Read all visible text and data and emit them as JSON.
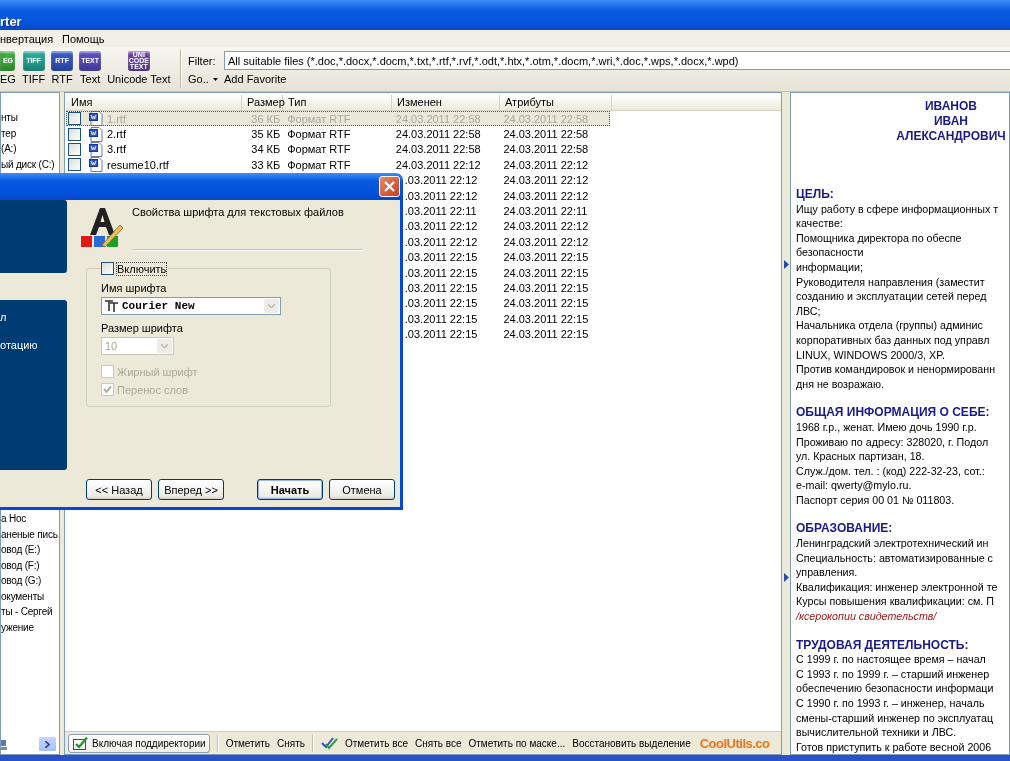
{
  "window": {
    "title": "rter"
  },
  "menu": [
    {
      "label": "нвертация"
    },
    {
      "label": "Помощь"
    }
  ],
  "toolbar": {
    "formats": [
      {
        "badge": "EG",
        "label": "EG",
        "color": "#3fae3c"
      },
      {
        "badge": "TIFF",
        "label": "TIFF",
        "color": "#27a89a"
      },
      {
        "badge": "RTF",
        "label": "RTF",
        "color": "#3558c4"
      },
      {
        "badge": "TEXT",
        "label": "Text",
        "color": "#5a4cc0"
      },
      {
        "badge": "UNI CODE TEXT",
        "label": "Unicode Text",
        "color": "#6d45b0"
      }
    ],
    "filter_label": "Filter:",
    "filter_value": "All suitable files (*.doc,*.docx,*.docm,*.txt,*.rtf,*.rvf,*.odt,*.htx,*.otm,*.docm,*.wri,*.doc,*.wps,*.docx,*.wpd)",
    "go": "Go..",
    "add_favorite": "Add Favorite"
  },
  "tree": {
    "items_top": [
      {
        "label": "нты"
      },
      {
        "label": "тер"
      },
      {
        "label": "(A:)"
      },
      {
        "label": "ый диск (C:)"
      }
    ],
    "items_bottom": [
      {
        "label": "а Нос"
      },
      {
        "label": "аненые пись"
      },
      {
        "label": "овод (E:)"
      },
      {
        "label": "овод (F:)"
      },
      {
        "label": "овод (G:)"
      },
      {
        "label": "окументы"
      },
      {
        "label": "ты - Сергей"
      },
      {
        "label": "ужение"
      }
    ]
  },
  "file_list": {
    "columns": [
      "Имя",
      "Размер",
      "Тип",
      "Изменен",
      "Атрибуты"
    ],
    "rows": [
      {
        "selected": true,
        "checked": false,
        "name": "1.rtf",
        "size": "36 КБ",
        "type": "Формат RTF",
        "modified": "24.03.2011 22:58",
        "attributes": "24.03.2011 22:58"
      },
      {
        "selected": false,
        "checked": false,
        "name": "2.rtf",
        "size": "35 КБ",
        "type": "Формат RTF",
        "modified": "24.03.2011 22:58",
        "attributes": "24.03.2011 22:58"
      },
      {
        "selected": false,
        "checked": false,
        "name": "3.rtf",
        "size": "34 КБ",
        "type": "Формат RTF",
        "modified": "24.03.2011 22:58",
        "attributes": "24.03.2011 22:58"
      },
      {
        "selected": false,
        "checked": false,
        "name": "resume10.rtf",
        "size": "33 КБ",
        "type": "Формат RTF",
        "modified": "24.03.2011 22:12",
        "attributes": "24.03.2011 22:12"
      },
      {
        "selected": false,
        "modified": ".03.2011 22:12",
        "attributes": "24.03.2011 22:12"
      },
      {
        "selected": false,
        "modified": ".03.2011 22:12",
        "attributes": "24.03.2011 22:12"
      },
      {
        "selected": false,
        "modified": ".03.2011 22:11",
        "attributes": "24.03.2011 22:11"
      },
      {
        "selected": false,
        "modified": ".03.2011 22:12",
        "attributes": "24.03.2011 22:12"
      },
      {
        "selected": false,
        "modified": ".03.2011 22:12",
        "attributes": "24.03.2011 22:12"
      },
      {
        "selected": false,
        "modified": ".03.2011 22:15",
        "attributes": "24.03.2011 22:15"
      },
      {
        "selected": false,
        "modified": ".03.2011 22:15",
        "attributes": "24.03.2011 22:15"
      },
      {
        "selected": false,
        "modified": ".03.2011 22:15",
        "attributes": "24.03.2011 22:15"
      },
      {
        "selected": false,
        "modified": ".03.2011 22:15",
        "attributes": "24.03.2011 22:15"
      },
      {
        "selected": false,
        "modified": ".03.2011 22:15",
        "attributes": "24.03.2011 22:15"
      },
      {
        "selected": false,
        "modified": ".03.2011 22:15",
        "attributes": "24.03.2011 22:15"
      }
    ]
  },
  "bottom_toolbar": [
    {
      "kind": "toggle",
      "label": "Включая поддиректории"
    },
    {
      "kind": "separator"
    },
    {
      "kind": "action",
      "label": "Отметить"
    },
    {
      "kind": "action",
      "label": "Снять"
    },
    {
      "kind": "separator"
    },
    {
      "kind": "action-icon",
      "label": "Отметить все"
    },
    {
      "kind": "action",
      "label": "Снять все"
    },
    {
      "kind": "action",
      "label": "Отметить по маске..."
    },
    {
      "kind": "action",
      "label": "Восстановить выделение"
    }
  ],
  "logo": "CoolUtils.co",
  "preview": {
    "name_lines": [
      "ИВАНОВ",
      "ИВАН",
      "АЛЕКСАНДРОВИЧ"
    ],
    "sections": [
      {
        "heading": "ЦЕЛЬ:",
        "lines": [
          {
            "kind": "text",
            "text": "Ищу работу в сфере информационных т"
          },
          {
            "kind": "text",
            "text": "качестве:"
          },
          {
            "kind": "text",
            "text": "Помощника директора по обеспе"
          },
          {
            "kind": "text",
            "text": "безопасности"
          },
          {
            "kind": "text",
            "text": "информации;"
          },
          {
            "kind": "text",
            "text": "Руководителя направления (заместит"
          },
          {
            "kind": "text",
            "text": "созданию и эксплуатации сетей перед"
          },
          {
            "kind": "text",
            "text": "ЛВС;"
          },
          {
            "kind": "text",
            "text": "Начальника отдела (группы) админис"
          },
          {
            "kind": "text",
            "text": "корпоративных баз данных под управл"
          },
          {
            "kind": "text",
            "text": "LINUX, WINDOWS 2000/3, XP."
          },
          {
            "kind": "text",
            "text": "Против командировок и ненормированн"
          },
          {
            "kind": "text",
            "text": "дня не возражаю."
          }
        ]
      },
      {
        "heading": "ОБЩАЯ ИНФОРМАЦИЯ О СЕБЕ:",
        "lines": [
          {
            "kind": "text",
            "text": "1968 г.р., женат. Имею дочь 1990 г.р."
          },
          {
            "kind": "text",
            "text": "Проживаю по адресу: 328020, г. Подол"
          },
          {
            "kind": "text",
            "text": "ул. Красных партизан, 18."
          },
          {
            "kind": "text",
            "text": "Служ./дом. тел. : (код) 222-32-23, сот.:"
          },
          {
            "kind": "text",
            "text": "e-mail: qwerty@mylo.ru."
          },
          {
            "kind": "text",
            "text": "Паспорт серия 00 01 № 011803."
          }
        ]
      },
      {
        "heading": "ОБРАЗОВАНИЕ:",
        "lines": [
          {
            "kind": "text",
            "text": "Ленинградский электротехнический ин"
          },
          {
            "kind": "text",
            "text": "Специальность: автоматизированные с"
          },
          {
            "kind": "text",
            "text": "управления."
          },
          {
            "kind": "text",
            "text": "Квалификация: инженер электронной те"
          },
          {
            "kind": "text",
            "text": "Курсы повышения квалификации: см. П"
          },
          {
            "kind": "note",
            "text": "/ксерокопии свидетельств/"
          }
        ]
      },
      {
        "heading": "ТРУДОВАЯ ДЕЯТЕЛЬНОСТЬ:",
        "lines": [
          {
            "kind": "text",
            "text": "С 1999 г. по настоящее время – начал"
          },
          {
            "kind": "text",
            "text": "С 1993 г. по 1999 г. – старший инженер"
          },
          {
            "kind": "text",
            "text": "обеспечению безопасности информаци"
          },
          {
            "kind": "text",
            "text": "С 1990 г. по 1993 г. – инженер, началь"
          },
          {
            "kind": "text",
            "text": "смены-старший инженер по эксплуатац"
          },
          {
            "kind": "text",
            "text": "вычислительной техники и ЛВС."
          },
          {
            "kind": "text",
            "text": "Готов приступить к работе весной 2006"
          }
        ]
      }
    ]
  },
  "dialog": {
    "sidebar_texts": [
      "л",
      "отацию"
    ],
    "header": "Свойства шрифта для текстовых файлов",
    "enable": {
      "label": "Включить",
      "checked": false
    },
    "fields": [
      {
        "kind": "font",
        "label": "Имя шрифта",
        "value": "Courier New",
        "disabled": false
      },
      {
        "kind": "size",
        "label": "Размер шрифта",
        "value": "10",
        "disabled": true
      }
    ],
    "options": [
      {
        "label": "Жирный шрифт",
        "checked": false,
        "disabled": true
      },
      {
        "label": "Перенос слов",
        "checked": true,
        "disabled": true
      }
    ],
    "buttons": [
      {
        "label": "<< Назад",
        "default": false
      },
      {
        "label": "Вперед >>",
        "default": false
      },
      {
        "label": "Начать",
        "default": true
      },
      {
        "label": "Отмена",
        "default": false
      }
    ]
  }
}
